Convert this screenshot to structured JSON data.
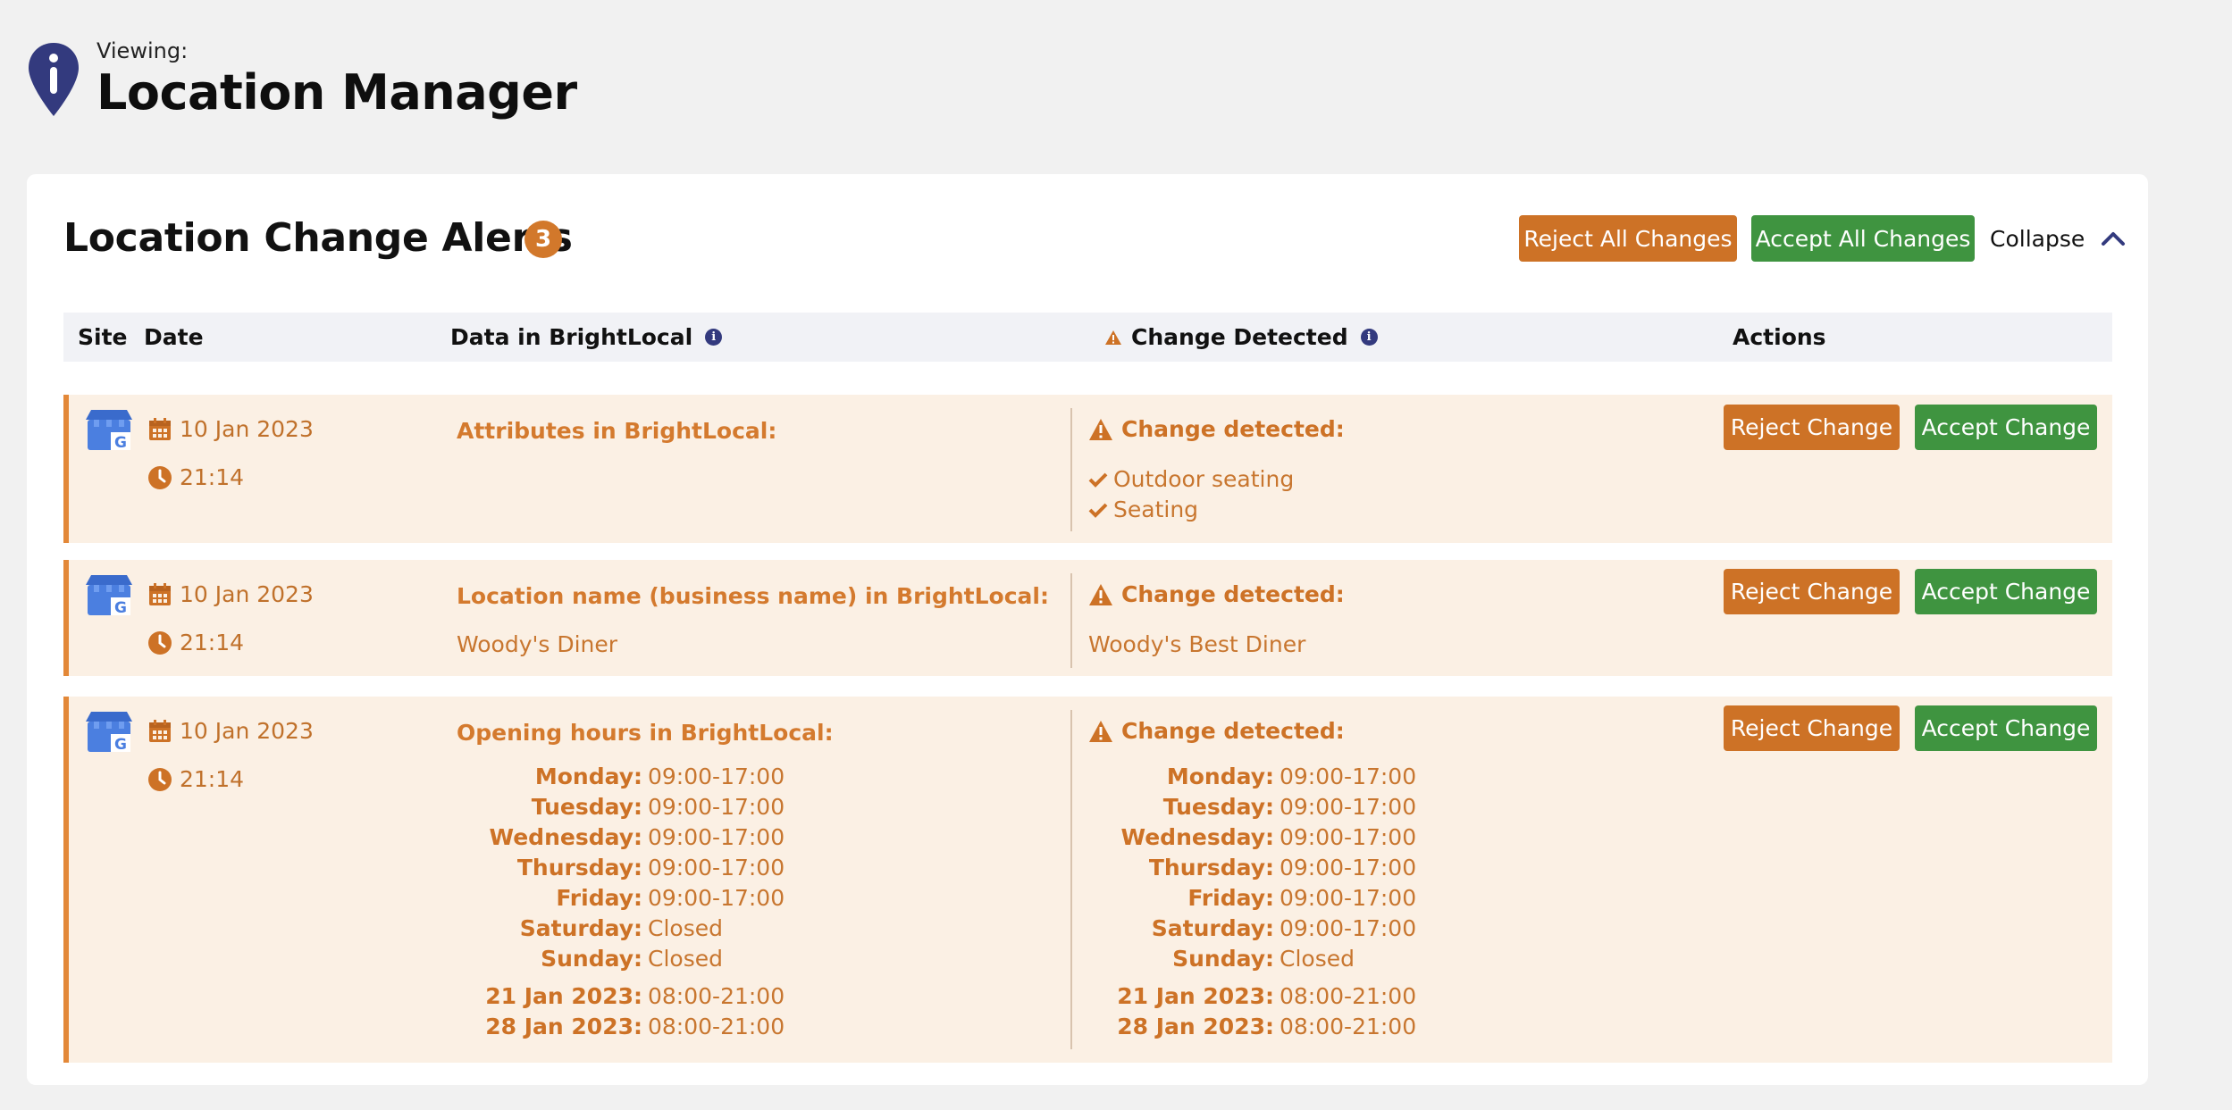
{
  "header": {
    "viewing_label": "Viewing:",
    "title": "Location Manager"
  },
  "card": {
    "title": "Location Change Alerts",
    "count": "3",
    "reject_all_label": "Reject All Changes",
    "accept_all_label": "Accept All Changes",
    "collapse_label": "Collapse"
  },
  "table": {
    "columns": {
      "site": "Site",
      "date": "Date",
      "data": "Data in BrightLocal",
      "change": "Change Detected",
      "actions": "Actions"
    }
  },
  "rows": [
    {
      "date": "10 Jan 2023",
      "time": "21:14",
      "bl_label": "Attributes in BrightLocal:",
      "change_label": "Change detected:",
      "change_items": [
        "Outdoor seating",
        "Seating"
      ],
      "reject_label": "Reject Change",
      "accept_label": "Accept Change"
    },
    {
      "date": "10 Jan 2023",
      "time": "21:14",
      "bl_label": "Location name (business name) in BrightLocal:",
      "bl_value": "Woody's Diner",
      "change_label": "Change detected:",
      "change_value": "Woody's Best Diner",
      "reject_label": "Reject Change",
      "accept_label": "Accept Change"
    },
    {
      "date": "10 Jan 2023",
      "time": "21:14",
      "bl_label": "Opening hours in BrightLocal:",
      "change_label": "Change detected:",
      "reject_label": "Reject Change",
      "accept_label": "Accept Change",
      "bl_hours": [
        {
          "day": "Monday",
          "time": "09:00-17:00"
        },
        {
          "day": "Tuesday",
          "time": "09:00-17:00"
        },
        {
          "day": "Wednesday",
          "time": "09:00-17:00"
        },
        {
          "day": "Thursday",
          "time": "09:00-17:00"
        },
        {
          "day": "Friday",
          "time": "09:00-17:00"
        },
        {
          "day": "Saturday",
          "time": "Closed"
        },
        {
          "day": "Sunday",
          "time": "Closed"
        },
        {
          "day": "21 Jan 2023",
          "time": "08:00-21:00"
        },
        {
          "day": "28 Jan 2023",
          "time": "08:00-21:00"
        }
      ],
      "change_hours": [
        {
          "day": "Monday",
          "time": "09:00-17:00"
        },
        {
          "day": "Tuesday",
          "time": "09:00-17:00"
        },
        {
          "day": "Wednesday",
          "time": "09:00-17:00"
        },
        {
          "day": "Thursday",
          "time": "09:00-17:00"
        },
        {
          "day": "Friday",
          "time": "09:00-17:00"
        },
        {
          "day": "Saturday",
          "time": "09:00-17:00"
        },
        {
          "day": "Sunday",
          "time": "Closed"
        },
        {
          "day": "21 Jan 2023",
          "time": "08:00-21:00"
        },
        {
          "day": "28 Jan 2023",
          "time": "08:00-21:00"
        }
      ]
    }
  ],
  "colors": {
    "accent_orange": "#cd7226",
    "accent_green": "#3f9440",
    "row_bg": "#fbf0e4",
    "row_border": "#e38838",
    "brand_navy": "#333a7e"
  },
  "icons": {
    "header": "location-pin-info-icon",
    "site": "google-business-profile-icon",
    "date": "calendar-icon",
    "time": "clock-icon",
    "warning": "warning-triangle-icon",
    "check": "check-icon",
    "info": "info-icon",
    "collapse": "chevron-up-icon"
  }
}
